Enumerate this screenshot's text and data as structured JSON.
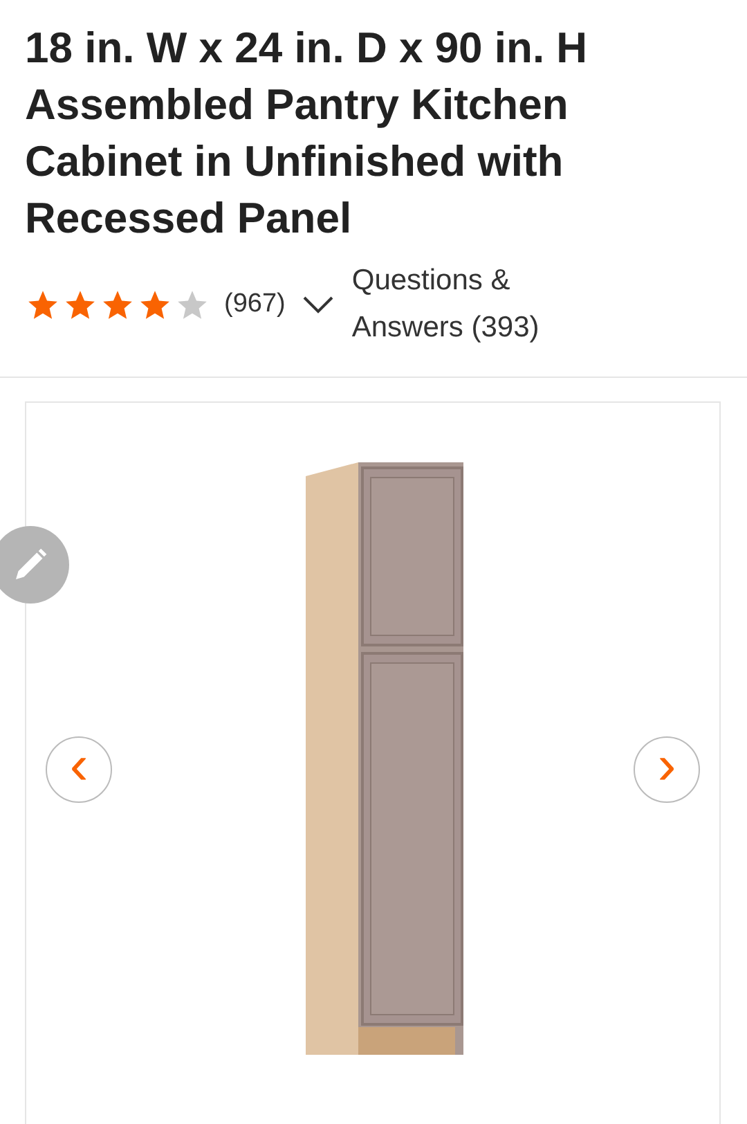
{
  "product": {
    "title": "18 in. W x 24 in. D x 90 in. H Assembled Pantry Kitchen Cabinet in Unfinished with Recessed Panel"
  },
  "rating": {
    "stars": 4,
    "count": "(967)",
    "qa_link": "Questions & Answers (393)"
  },
  "gallery": {
    "previous_label": "‹",
    "next_label": "›"
  }
}
